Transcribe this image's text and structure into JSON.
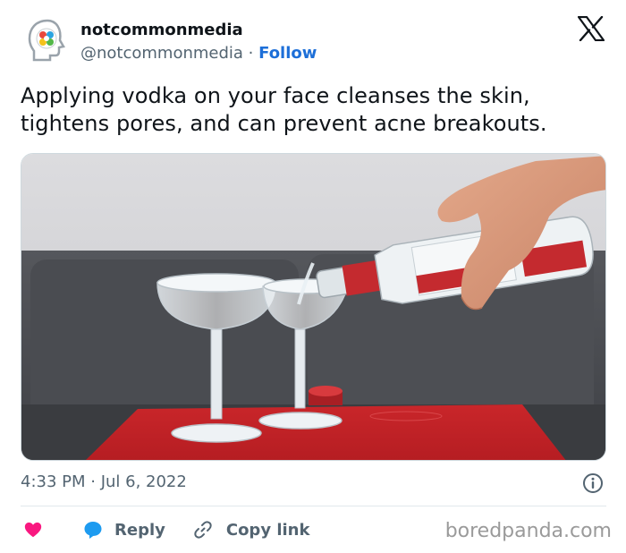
{
  "account": {
    "display_name": "notcommonmedia",
    "handle": "@notcommonmedia",
    "separator": " · ",
    "follow_label": "Follow"
  },
  "tweet": {
    "text": "Applying vodka on your face cleanses the skin, tightens pores, and can prevent acne breakouts.",
    "timestamp": "4:33 PM · Jul 6, 2022"
  },
  "actions": {
    "reply_label": "Reply",
    "copy_link_label": "Copy link"
  },
  "watermark": "boredpanda.com",
  "icons": {
    "x_logo": "x-logo-icon",
    "info": "info-icon",
    "heart": "heart-icon",
    "reply": "speech-bubble-icon",
    "link": "link-icon"
  },
  "colors": {
    "follow": "#1d6fd8",
    "heart": "#f91880",
    "reply_icon": "#1d9bf0",
    "muted_text": "#536471"
  }
}
